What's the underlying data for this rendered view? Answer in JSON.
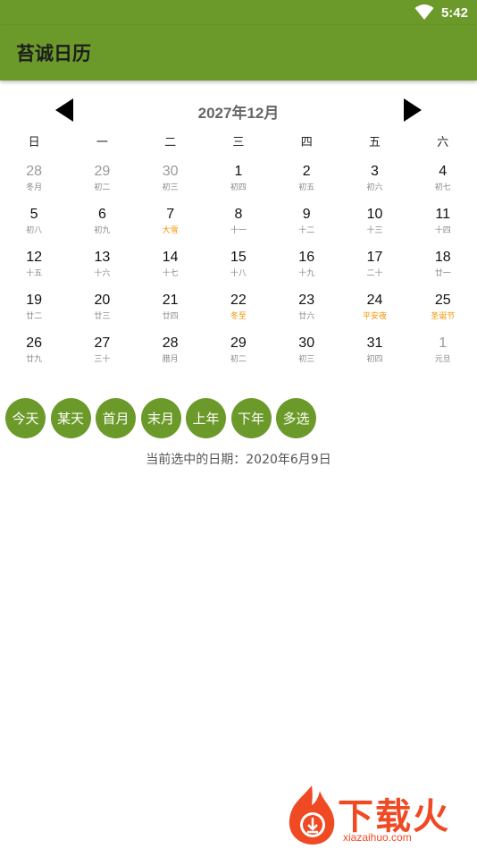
{
  "status": {
    "time": "5:42"
  },
  "app": {
    "title": "苔诚日历"
  },
  "calendar": {
    "month_title": "2027年12月",
    "weekdays": [
      "日",
      "一",
      "二",
      "三",
      "四",
      "五",
      "六"
    ],
    "weeks": [
      [
        {
          "day": "28",
          "lunar": "冬月",
          "other_month": true
        },
        {
          "day": "29",
          "lunar": "初二",
          "other_month": true
        },
        {
          "day": "30",
          "lunar": "初三",
          "other_month": true
        },
        {
          "day": "1",
          "lunar": "初四"
        },
        {
          "day": "2",
          "lunar": "初五"
        },
        {
          "day": "3",
          "lunar": "初六"
        },
        {
          "day": "4",
          "lunar": "初七"
        }
      ],
      [
        {
          "day": "5",
          "lunar": "初八"
        },
        {
          "day": "6",
          "lunar": "初九"
        },
        {
          "day": "7",
          "lunar": "大雪",
          "festival": true
        },
        {
          "day": "8",
          "lunar": "十一"
        },
        {
          "day": "9",
          "lunar": "十二"
        },
        {
          "day": "10",
          "lunar": "十三"
        },
        {
          "day": "11",
          "lunar": "十四"
        }
      ],
      [
        {
          "day": "12",
          "lunar": "十五"
        },
        {
          "day": "13",
          "lunar": "十六"
        },
        {
          "day": "14",
          "lunar": "十七"
        },
        {
          "day": "15",
          "lunar": "十八"
        },
        {
          "day": "16",
          "lunar": "十九"
        },
        {
          "day": "17",
          "lunar": "二十"
        },
        {
          "day": "18",
          "lunar": "廿一"
        }
      ],
      [
        {
          "day": "19",
          "lunar": "廿二"
        },
        {
          "day": "20",
          "lunar": "廿三"
        },
        {
          "day": "21",
          "lunar": "廿四"
        },
        {
          "day": "22",
          "lunar": "冬至",
          "festival": true
        },
        {
          "day": "23",
          "lunar": "廿六"
        },
        {
          "day": "24",
          "lunar": "平安夜",
          "festival": true
        },
        {
          "day": "25",
          "lunar": "圣诞节",
          "festival": true
        }
      ],
      [
        {
          "day": "26",
          "lunar": "廿九"
        },
        {
          "day": "27",
          "lunar": "三十"
        },
        {
          "day": "28",
          "lunar": "腊月"
        },
        {
          "day": "29",
          "lunar": "初二"
        },
        {
          "day": "30",
          "lunar": "初三"
        },
        {
          "day": "31",
          "lunar": "初四"
        },
        {
          "day": "1",
          "lunar": "元旦",
          "other_month": true
        }
      ]
    ]
  },
  "actions": [
    {
      "label": "今天",
      "name": "today-button"
    },
    {
      "label": "某天",
      "name": "some-day-button"
    },
    {
      "label": "首月",
      "name": "first-month-button"
    },
    {
      "label": "末月",
      "name": "last-month-button"
    },
    {
      "label": "上年",
      "name": "previous-year-button"
    },
    {
      "label": "下年",
      "name": "next-year-button"
    },
    {
      "label": "多选",
      "name": "multi-select-button"
    }
  ],
  "selected_date_text": "当前选中的日期：2020年6月9日",
  "watermark": {
    "text": "下载火",
    "url": "xiazaihuo.com"
  },
  "colors": {
    "primary": "#6c9a2a",
    "festival": "#f29400",
    "watermark": "#ef4a23"
  }
}
